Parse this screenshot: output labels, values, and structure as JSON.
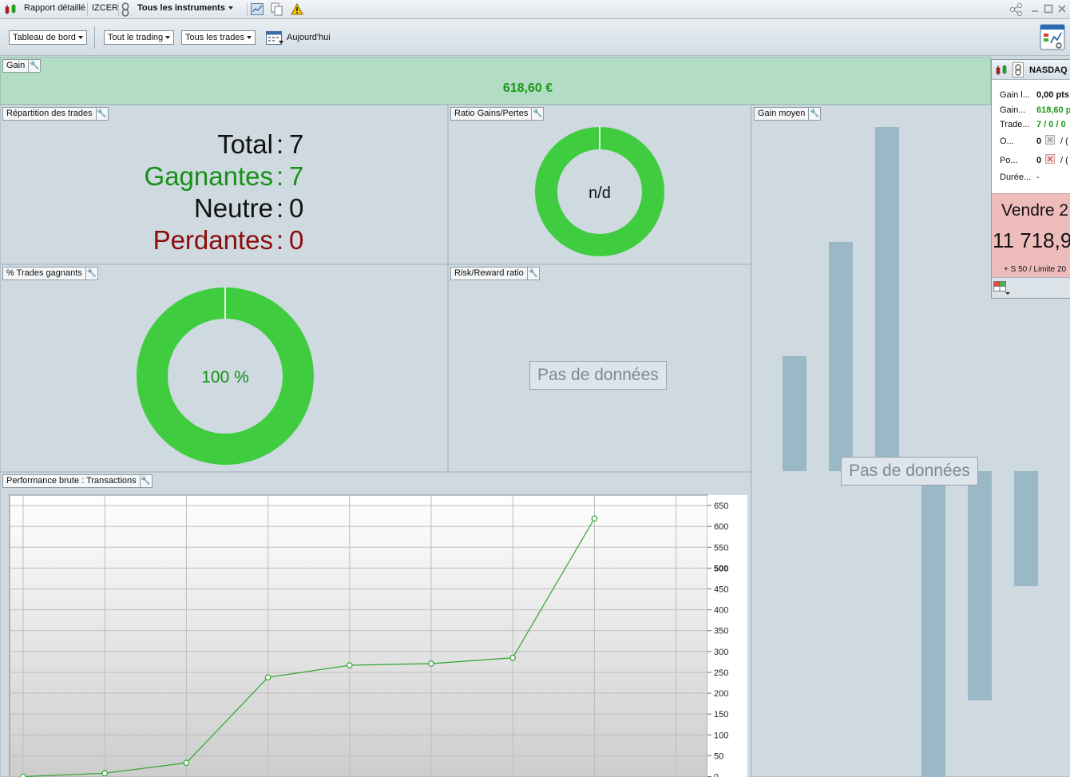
{
  "titlebar": {
    "report_label": "Rapport détaillé",
    "account": "IZCER",
    "instruments": "Tous les instruments"
  },
  "toolbar": {
    "dashboard": "Tableau de bord",
    "trading": "Tout le trading",
    "trades": "Tous les trades",
    "date": "Aujourd'hui"
  },
  "gain": {
    "title": "Gain",
    "value": "618,60 €"
  },
  "repartition": {
    "title": "Répartition des trades",
    "rows": [
      {
        "label": "Total",
        "sep": ":",
        "value": "7"
      },
      {
        "label": "Gagnantes",
        "sep": ":",
        "value": "7"
      },
      {
        "label": "Neutre",
        "sep": ":",
        "value": "0"
      },
      {
        "label": "Perdantes",
        "sep": ":",
        "value": "0"
      }
    ]
  },
  "ratio": {
    "title": "Ratio Gains/Pertes",
    "center": "n/d",
    "fraction": 1.0
  },
  "pct": {
    "title": "% Trades gagnants",
    "center": "100 %",
    "fraction": 1.0
  },
  "rr": {
    "title": "Risk/Reward ratio",
    "nodata": "Pas de données"
  },
  "gainmoyen": {
    "title": "Gain moyen",
    "nodata": "Pas de données"
  },
  "perf": {
    "title": "Performance brute : Transactions"
  },
  "instrument": {
    "name": "NASDAQ",
    "rows": [
      {
        "label": "Gain l...",
        "value": "0,00 pts"
      },
      {
        "label": "Gain...",
        "value": "618,60 p"
      },
      {
        "label": "Trade...",
        "value": "7 / 0 / 0"
      },
      {
        "label": "O...",
        "value": "0"
      },
      {
        "label": "Po...",
        "value": "0"
      },
      {
        "label": "Durée...",
        "value": "-"
      }
    ],
    "slash": "/",
    "slash_tail": "(",
    "order_side": "Vendre 2",
    "order_price": "11 718,9",
    "order_details": "+ S 50 / Limite 20"
  },
  "colors": {
    "green": "#3fcc3f",
    "gain_bg": "#b2dcc4",
    "sell_bg": "#efbcbc",
    "bar": "#9ab8c6",
    "line": "#2da52d"
  },
  "chart_data": {
    "type": "line",
    "title": "",
    "x": [
      0,
      1,
      2,
      3,
      4,
      5,
      6,
      7
    ],
    "values": [
      0,
      8,
      33,
      238,
      267,
      271,
      285,
      619
    ],
    "ylim": [
      0,
      650
    ],
    "yticks": [
      0,
      50,
      100,
      150,
      200,
      250,
      300,
      350,
      400,
      450,
      500,
      550,
      600,
      650
    ],
    "grid": true
  }
}
